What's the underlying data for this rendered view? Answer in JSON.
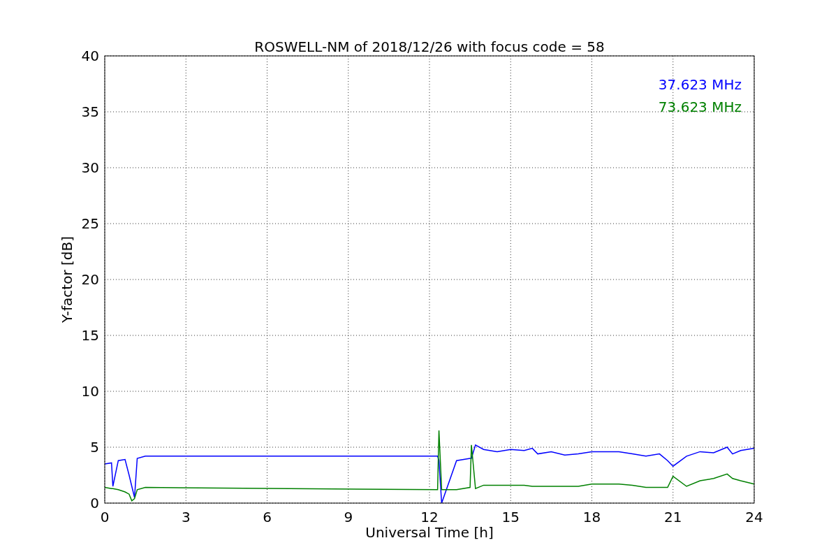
{
  "chart_data": {
    "type": "line",
    "title": "ROSWELL-NM of 2018/12/26 with focus code = 58",
    "xlabel": "Universal Time [h]",
    "ylabel": "Y-factor [dB]",
    "x": [
      0,
      0.25,
      0.3,
      0.5,
      0.75,
      0.9,
      1.0,
      1.1,
      1.2,
      1.5,
      12.3,
      12.35,
      12.45,
      13,
      13.5,
      13.55,
      13.7,
      14,
      14.5,
      15,
      15.5,
      15.8,
      16,
      16.5,
      17,
      17.5,
      18,
      18.5,
      19,
      19.5,
      20,
      20.5,
      20.8,
      21,
      21.5,
      22,
      22.5,
      23,
      23.2,
      23.5,
      24
    ],
    "series": [
      {
        "name": "37.623 MHz",
        "color": "#0000ff",
        "values": [
          3.5,
          3.6,
          1.5,
          3.8,
          3.9,
          2.5,
          1.5,
          0.5,
          4.0,
          4.2,
          4.2,
          3.8,
          0.0,
          3.8,
          4.0,
          4.0,
          5.2,
          4.8,
          4.6,
          4.8,
          4.7,
          4.9,
          4.4,
          4.6,
          4.3,
          4.4,
          4.6,
          4.6,
          4.6,
          4.4,
          4.2,
          4.4,
          3.8,
          3.3,
          4.2,
          4.6,
          4.5,
          5.0,
          4.4,
          4.7,
          4.9
        ]
      },
      {
        "name": "73.623 MHz",
        "color": "#008000",
        "values": [
          1.4,
          1.3,
          1.3,
          1.2,
          1.0,
          0.8,
          0.2,
          0.4,
          1.2,
          1.4,
          1.2,
          6.5,
          1.2,
          1.2,
          1.4,
          5.2,
          1.3,
          1.6,
          1.6,
          1.6,
          1.6,
          1.5,
          1.5,
          1.5,
          1.5,
          1.5,
          1.7,
          1.7,
          1.7,
          1.6,
          1.4,
          1.4,
          1.4,
          2.4,
          1.5,
          2.0,
          2.2,
          2.6,
          2.2,
          2.0,
          1.7
        ]
      }
    ],
    "xlim": [
      0,
      24
    ],
    "ylim": [
      0,
      40
    ],
    "xticks": [
      0,
      3,
      6,
      9,
      12,
      15,
      18,
      21,
      24
    ],
    "yticks": [
      0,
      5,
      10,
      15,
      20,
      25,
      30,
      35,
      40
    ],
    "grid": true
  }
}
